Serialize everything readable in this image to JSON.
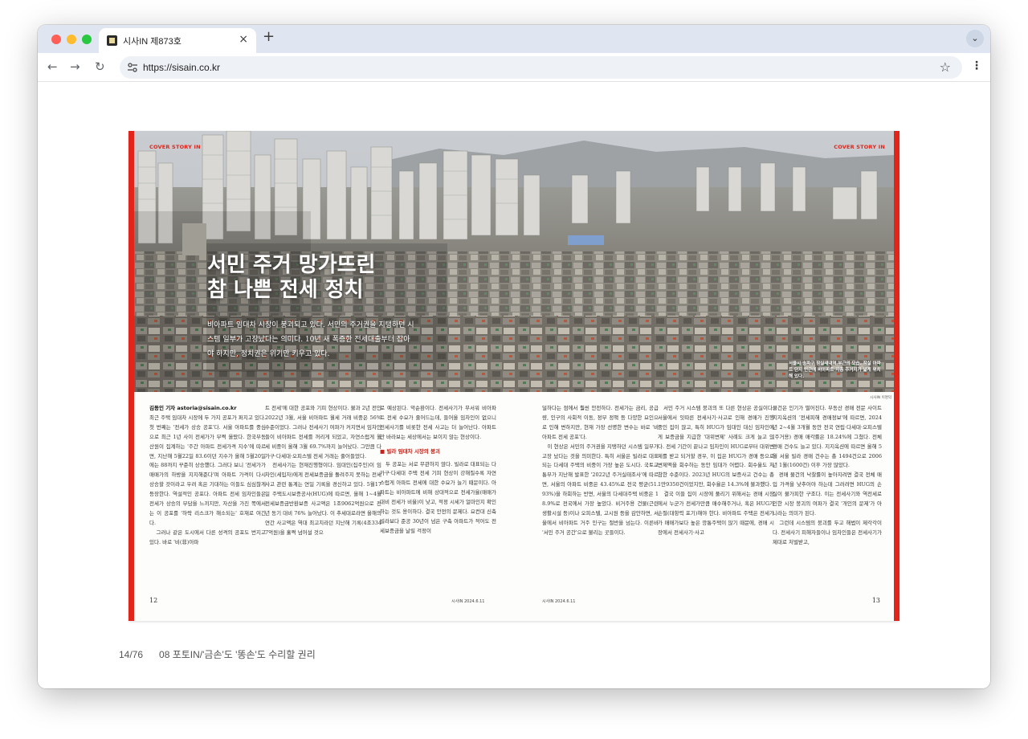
{
  "browser": {
    "tab_title": "시사IN 제873호",
    "tab_close": "×",
    "new_tab": "+",
    "tab_menu": "⌄",
    "url": "https://sisain.co.kr",
    "back": "←",
    "forward": "→",
    "reload": "↻",
    "bookmark": "☆",
    "menu": "⋮",
    "colors": {
      "close": "#ff5f57",
      "minimize": "#febc2e",
      "maximize": "#28c840"
    }
  },
  "spread": {
    "cover_tag_left": "COVER STORY IN",
    "cover_tag_right": "COVER STORY IN",
    "headline_line1": "서민 주거 망가뜨린",
    "headline_line2": "참 나쁜 전세 정치",
    "deck": "비아파트 임대차 시장이 붕괴되고 있다. 서민의 주거권을 지탱하던 시스템 일부가 고장났다는 의미다. 10년 새 폭증한 전세대출부터 잡아야 하지만, 정치권은 위기만 키우고 있다.",
    "photo_caption": "서울시 송파구 잠실새내역 부근의 모습. 잠실 아파트 단지 인근에 비아파트 지층 주거지가 넓게 위치해 있다.",
    "photo_credit": "시사IN 이명익",
    "byline": "김동인 기자 astoria@sisain.co.kr",
    "col1": "최근 주택 임대차 시장에 두 가지 공포가 퍼지고 있다. 첫 번째는 '전세가 상승 공포'다. 서울 아파트를 중심으로 최근 1년 사이 전세가가 부쩍 올랐다. 한국부동산원이 집계하는 '주간 아파트 전세가격 지수'에 따르면, 지난해 5월22일 83.6이던 지수가 올해 5월20일에는 88까지 꾸준히 상승했다. 그러다 보니 '전세가가 매매가의 하방을 지지해준다'며 아파트 가격이 다시 상승할 것이라고 우려 혹은 기대하는 이들도 심심찮게 등장한다. 역설적인 공포다. 아파트 전세 임차인들은 전세가 상승의 부담을 느끼지만, 자산을 가진 쪽에서는 이 공포를 '하락 리스크가 해소되는' 호재로 여긴다.\n   그러나 같은 도시에서 다른 성격의 공포도 번지고 있다. 바로 '비(非)아파",
    "col2": "트 전세'에 대한 공포와 기피 현상이다. 불과 2년 전인 2022년 3월, 서울 비아파트 월세 거래 비중은 56% 수준이었다. 그러나 전세사기 여파가 커지면서 임차인들이 비아파트 전세를 꺼리게 되었고, 자연스럽게 월세 비중이 올해 3월 69.7%까지 늘어났다. 그만큼 다가구·다세대·오피스텔 전세 거래는 줄어들었다.\n   전세사기는 현재진행형이다. 임대인(집주인)이 임차인(세입자)에게 전세보증금을 돌려주지 못하는 전세 사고 관련 통계는 연일 기록을 경신하고 있다. 5월17일 주택도시보증공사(HUG)에 따르면, 올해 1~4월 전세보증금반환보증 사고액은 1조9062억원으로 전년 동기 대비 76% 늘어났다. 이 추세대로라면 올해의 연간 사고액은 역대 최고치라던 지난해 기록(4조3347억원)을 훌쩍 넘어설 것으",
    "col3": "로 예상된다. 악순환이다. 전세사기가 무서워 비아파트 전세 수요가 줄어드는데, 들어올 임차인이 없으니 전세사기를 비롯한 전세 사고는 더 늘어난다. 아파트만 바라보는 세상에서는 보이지 않는 현상이다.",
    "col3_sub": "■ 빌라 임대차 시장의 붕괴",
    "col3b": "   두 공포는 서로 무관하지 않다. 빌라로 대표되는 다가구·다세대 주택 전세 기피 현상이 강해질수록 자연스럽게 아파트 전세에 대한 수요가 늘기 때문이다. 아파트는 비아파트에 비해 상대적으로 전세가율(매매가 대비 전세가 비율)이 낮고, 적정 시세가 얼마인지 확인하는 것도 용이하다. 결국 안전의 문제다. 요컨대 신축 빌라보다 준공 30년이 넘은 구축 아파트가 적어도 전세보증금을 날릴 걱정이",
    "col4": "덜하다는 점에서 훨씬 안전하다. 전세가는 금리, 공급량, 인구의 사회적 이동, 정부 정책 등 다양한 요인으로 인해 변하지만, 현재 가장 선명한 변수는 바로 '비아파트 전세 공포'다.\n   이 현상은 서민의 주거권을 지탱하던 시스템 일부가 고장 났다는 것을 의미한다. 특히 서울은 빌라로 대표되는 다세대 주택의 비중이 가장 높은 도시다. 국토교통부가 지난해 발표한 '2022년 주거실태조사'에 따르면, 서울의 아파트 비중은 43.45%로 전국 평균(51.93%)을 하회하는 반면, 서울의 다세대주택 비중은 18.9%로 전국에서 가장 높았다. 비거주용 건물(근린생활시설 등)이나 오피스텔, 고시원 등을 감안하면, 서울에서 비아파트 거주 인구는 절반을 넘는다. 이른바 '서민 주거 공간'으로 불리는 곳들이다.",
    "col5": "   서민 주거 시스템 붕괴의 또 다른 현상은 공실이다. 서울에서 잇따른 전세사기·사고로 인해 경매가 진행 중인 집이 많고, 특히 HUG가 임대인 대신 임차인에게 보증금을 지급한 '대위변제' 사례도 크게 늘고 있다. 전세 기간이 끝나고 임차인이 HUG로부터 대위변제를 받고 되거할 경우, 이 집은 HUG가 경매 등으로 변제액을 회수하는 동안 임대가 어렵다. 회수율도 처참한 수준이다. 2023년 HUG의 보증사고 건수는 총 1만9350건이었지만, 회수율은 14.3%에 불과했다.\n   결국 이들 집이 시장에 풀리기 위해서는 경매 시장에서 누군가 전세가만큼 매수해주거나, 혹은 HUG가 손절(대항력 포기)해야 한다. 비아파트 주택은 전세가가 매매가보다 높은 깡통주택이 많기 때문에, 경매 시장에서 전세사기·사고",
    "col6": "물건은 인기가 떨어진다. 부동산 경매 전문 사이트 지지옥션의 '전세피해 경매정보'에 따르면, 2024년 2~4월 3개월 동안 전국 연립·다세대·오피스텔(주거용) 경매 매각률은 18.24%에 그쳤다. 전체 경매 건수도 늘고 있다. 지지옥션에 따르면 올해 5월 서울 빌라 경매 건수는 총 1494건으로 2006년 1월(1600건) 이후 가장 많았다.\n   경매 물건의 낙찰률이 높아지려면 결국 전체 매입 가격을 낮추어야 하는데 그러려면 HUG의 손실이 불가피한 구조다. 이는 전세사기와 역전세로 인한 시장 붕괴의 여파가 결국 '개인의 문제'가 아니라는 의미가 된다.\n   그런데 시스템의 붕괴를 두고 해법이 제각각이다. 전세사기 피해자들이나 임차인들은 전세사기가 제대로 처벌받고,",
    "folio_left": "12",
    "folio_right": "13",
    "runner_left": "시사IN 2024.6.11",
    "runner_right": "시사IN 2024.6.11"
  },
  "viewer": {
    "page_counter": "14/76",
    "article_title": "08 포토IN/'금손'도 '똥손'도 수리할 권리"
  }
}
